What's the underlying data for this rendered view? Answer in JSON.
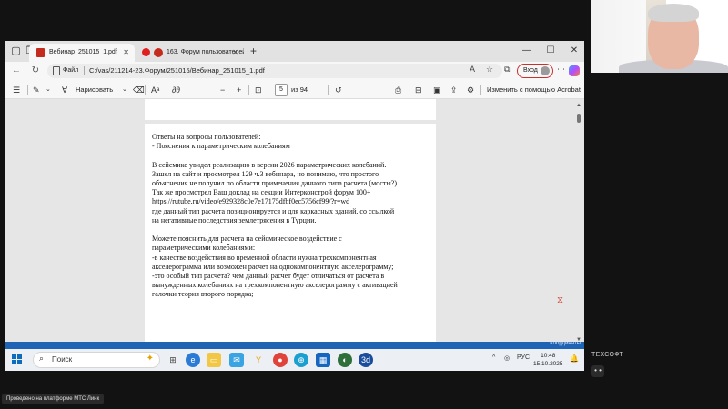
{
  "browser": {
    "tabs": [
      {
        "label": "Вебинар_251015_1.pdf",
        "active": true
      },
      {
        "label": "163. Форум пользователей",
        "active": false
      }
    ],
    "new_tab": "+",
    "window_controls": {
      "minimize": "—",
      "maximize": "☐",
      "close": "✕"
    },
    "address": {
      "scheme_label": "Файл",
      "url": "C:/vas/211214-23.Форум/251015/Вебинар_251015_1.pdf"
    },
    "login_label": "Вход"
  },
  "pdf_toolbar": {
    "draw_label": "Нарисовать",
    "page_current": "5",
    "page_total": "из 94",
    "edit_with_acrobat": "Изменить с помощью Acrobat"
  },
  "document": {
    "lines": [
      "Ответы на вопросы пользователей:",
      "-      Пояснения к параметрическим колебаниям",
      "",
      "В сейсмике увидел реализацию в версии 2026 параметрических колебаний.",
      "Зашел на сайт и просмотрел 129 ч.3 вебинара, но понимаю, что простого",
      "объяснения не получил по области применения данного типа расчета (мосты?).",
      "Так же просмотрел Ваш доклад на секции Интерконстрой форум 100+",
      "https://rutube.ru/video/e929328c0e7e17175dfbf0ec5756cf99/?r=wd",
      "где данный тип расчета позиционируется и для каркасных зданий, со ссылкой",
      "на негативные последствия землетрясения в Турции.",
      "",
      "Можете пояснить для расчета на сейсмическое воздействие с",
      "параметрическими колебаниями:",
      "-в качестве воздействия во временной области  нужна трехкомпонентная",
      "акселерограмма или возможен расчет на однокомпонентную акселерограмму;",
      "-это особый тип расчета? чем данный расчет будет  отличаться  от расчета в",
      "вынужденных колебаниях на трехкомпонентную акселерограмму с активацией",
      "галочки теория второго порядка;"
    ]
  },
  "app_status": {
    "label": "Координаты"
  },
  "taskbar": {
    "search_label": "Поиск",
    "language": "РУС",
    "time": "10:48",
    "date": "15.10.2025"
  },
  "webcam": {
    "participant_name": "ТЕХСОФТ",
    "more_label": "• •"
  },
  "platform_badge": "Проведено на платформе МТС Линк",
  "colors": {
    "accent_blue": "#1e63b4",
    "pdf_red": "#c42b1c",
    "login_border": "#c9302c"
  }
}
